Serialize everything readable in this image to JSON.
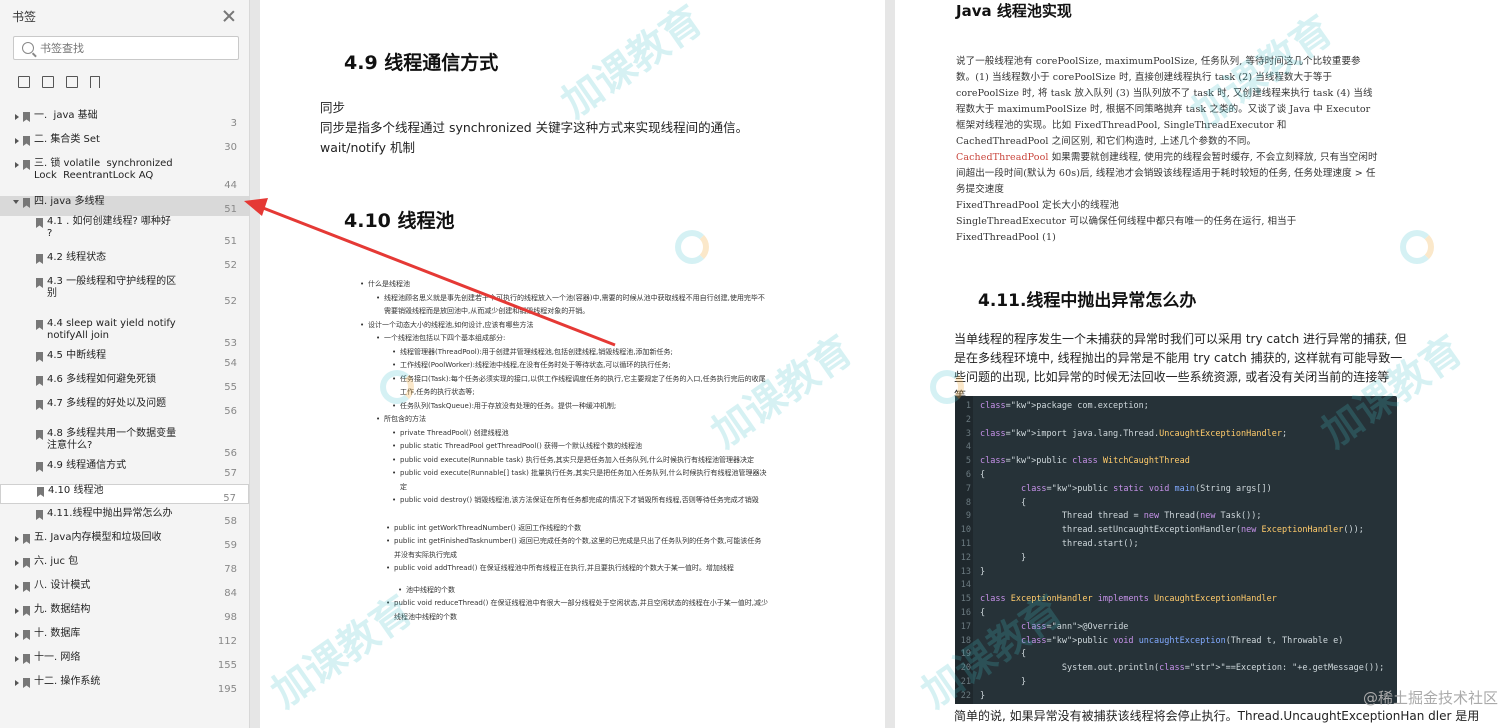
{
  "sidebar": {
    "title": "书签",
    "search_placeholder": "书签查找",
    "items": [
      {
        "label": "一.  java 基础",
        "page": "3",
        "level": 0,
        "state": "collapsed"
      },
      {
        "label": "二. 集合类 Set",
        "page": "30",
        "level": 0,
        "state": "collapsed"
      },
      {
        "label": "三. 锁 volatile  synchronized\nLock  ReentrantLock AQ",
        "page": "44",
        "level": 0,
        "state": "collapsed"
      },
      {
        "label": "四. java 多线程",
        "page": "51",
        "level": 0,
        "state": "expanded"
      },
      {
        "label": "4.1 . 如何创建线程? 哪种好\n?",
        "page": "51",
        "level": 1
      },
      {
        "label": "4.2 线程状态",
        "page": "52",
        "level": 1
      },
      {
        "label": "4.3 一般线程和守护线程的区\n别",
        "page": "52",
        "level": 1
      },
      {
        "label": "4.4 sleep wait yield notify\nnotifyAll join",
        "page": "53",
        "level": 1
      },
      {
        "label": "4.5 中断线程",
        "page": "54",
        "level": 1
      },
      {
        "label": "4.6 多线程如何避免死锁",
        "page": "55",
        "level": 1
      },
      {
        "label": "4.7 多线程的好处以及问题",
        "page": "56",
        "level": 1
      },
      {
        "label": "4.8 多线程共用一个数据变量\n注意什么?",
        "page": "56",
        "level": 1
      },
      {
        "label": "4.9 线程通信方式",
        "page": "57",
        "level": 1
      },
      {
        "label": "4.10 线程池",
        "page": "57",
        "level": 1
      },
      {
        "label": "4.11.线程中抛出异常怎么办",
        "page": "58",
        "level": 1
      },
      {
        "label": "五. Java内存模型和垃圾回收",
        "page": "59",
        "level": 0,
        "state": "collapsed"
      },
      {
        "label": "六. juc 包",
        "page": "78",
        "level": 0,
        "state": "collapsed"
      },
      {
        "label": "八. 设计模式",
        "page": "84",
        "level": 0,
        "state": "collapsed"
      },
      {
        "label": "九. 数据结构",
        "page": "98",
        "level": 0,
        "state": "collapsed"
      },
      {
        "label": "十. 数据库",
        "page": "112",
        "level": 0,
        "state": "collapsed"
      },
      {
        "label": "十一. 网络",
        "page": "155",
        "level": 0,
        "state": "collapsed"
      },
      {
        "label": "十二. 操作系统",
        "page": "195",
        "level": 0,
        "state": "collapsed"
      }
    ]
  },
  "page1": {
    "h_49": "4.9 线程通信方式",
    "p1": "同步",
    "p2": "同步是指多个线程通过 synchronized 关键字这种方式来实现线程间的通信。",
    "p3": "wait/notify 机制",
    "h_410": "4.10 线程池",
    "list": [
      "什么是线程池",
      "线程池顾名思义就是事先创建若干个可执行的线程放入一个池(容器)中,需要的时候从池中获取线程不用自行创建,使用完毕不需要销毁线程而是放回池中,从而减少创建和销毁线程对象的开销。",
      "设计一个动态大小的线程池,如何设计,应该有哪些方法",
      "一个线程池包括以下四个基本组成部分:",
      "线程管理器(ThreadPool):用于创建并管理线程池,包括创建线程,销毁线程池,添加新任务;",
      "工作线程(PoolWorker):线程池中线程,在没有任务时处于等待状态,可以循环的执行任务;",
      "任务接口(Task):每个任务必须实现的接口,以供工作线程调度任务的执行,它主要规定了任务的入口,任务执行完后的收尾工作,任务的执行状态等;",
      "任务队列(TaskQueue):用于存放没有处理的任务。提供一种缓冲机制;",
      "所包含的方法",
      "private ThreadPool()  创建线程池",
      "public static ThreadPool getThreadPool()  获得一个默认线程个数的线程池",
      "public void execute(Runnable task)  执行任务,其实只是把任务加入任务队列,什么时候执行有线程池管理器决定",
      "public void execute(Runnable[] task)  批量执行任务,其实只是把任务加入任务队列,什么时候执行有线程池管理器决定",
      "public void destroy()  销毁线程池,该方法保证在所有任务都完成的情况下才销毁所有线程,否则等待任务完成才销毁",
      "public int getWorkThreadNumber() 返回工作线程的个数",
      "public int getFinishedTasknumber() 返回已完成任务的个数,这里的已完成是只出了任务队列的任务个数,可能该任务并没有实际执行完成",
      "public void addThread() 在保证线程池中所有线程正在执行,并且要执行线程的个数大于某一值时。增加线程",
      "池中线程的个数",
      "public void reduceThread() 在保证线程池中有很大一部分线程处于空闲状态,并且空闲状态的线程在小于某一值时,减少线程池中线程的个数"
    ]
  },
  "page2": {
    "h_java": "Java 线程池实现",
    "para1": "说了一般线程池有 corePoolSize, maximumPoolSize, 任务队列, 等待时间这几个比较重要参数。(1) 当线程数小于 corePoolSize 时, 直接创建线程执行 task (2) 当线程数大于等于 corePoolSize 时, 将 task 放入队列 (3) 当队列放不了 task 时, 又创建线程来执行 task (4) 当线程数大于 maximumPoolSize 时, 根据不同策略抛弃 task 之类的。又谈了谈 Java 中 Executor 框架对线程池的实现。比如 FixedThreadPool, SingleThreadExecutor 和 CachedThreadPool 之间区别, 和它们构造时, 上述几个参数的不同。",
    "cached_label": "CachedThreadPool",
    "cached_text": " 如果需要就创建线程, 使用完的线程会暂时缓存, 不会立刻释放, 只有当空闲时间超出一段时间(默认为 60s)后, 线程池才会销毁该线程适用于耗时较短的任务, 任务处理速度 > 任务提交速度",
    "fixed": "FixedThreadPool  定长大小的线程池",
    "single": "SingleThreadExecutor 可以确保任何线程中都只有唯一的任务在运行, 相当于 FixedThreadPool (1)",
    "h_411": "4.11.线程中抛出异常怎么办",
    "para2": "当单线程的程序发生一个未捕获的异常时我们可以采用 try  catch 进行异常的捕获, 但是在多线程环境中, 线程抛出的异常是不能用 try    catch 捕获的, 这样就有可能导致一些问题的出现, 比如异常的时候无法回收一些系统资源, 或者没有关闭当前的连接等等。",
    "code_lines": [
      "package com.exception;",
      "",
      "import java.lang.Thread.UncaughtExceptionHandler;",
      "",
      "public class WitchCaughtThread",
      "{",
      "        public static void main(String args[])",
      "        {",
      "                Thread thread = new Thread(new Task());",
      "                thread.setUncaughtExceptionHandler(new ExceptionHandler());",
      "                thread.start();",
      "        }",
      "}",
      "",
      "class ExceptionHandler implements UncaughtExceptionHandler",
      "{",
      "        @Override",
      "        public void uncaughtException(Thread t, Throwable e)",
      "        {",
      "                System.out.println(\"==Exception: \"+e.getMessage());",
      "        }",
      "}"
    ],
    "bottom": "简单的说, 如果异常没有被捕获该线程将会停止执行。Thread.UncaughtExceptionHan dler 是用"
  },
  "watermark_text": "加课教育",
  "footer_mark": "@稀土掘金技术社区",
  "colors": {
    "accent_red": "#e53935",
    "code_bg": "#263238"
  }
}
